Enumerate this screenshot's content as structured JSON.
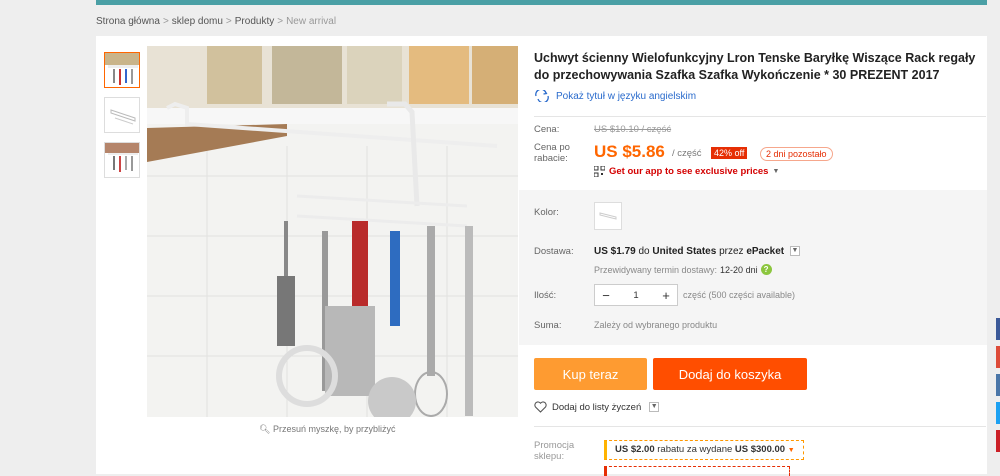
{
  "breadcrumb": {
    "items": [
      "Strona główna",
      "sklep domu",
      "Produkty"
    ],
    "current": "New arrival",
    "separator": ">"
  },
  "gallery": {
    "zoom_hint": "Przesuń myszkę, by przybliżyć"
  },
  "product": {
    "title": "Uchwyt ścienny Wielofunkcyjny Lron Tenske Baryłkę Wiszące Rack regały do przechowywania Szafka Szafka Wykończenie * 30 PREZENT 2017",
    "english_title_link": "Pokaż tytuł w języku angielskim"
  },
  "price": {
    "label": "Cena:",
    "original": "US $10.10 / część",
    "discount_label": "Cena po rabacie:",
    "current": "US $5.86",
    "unit": "/ część",
    "off_badge": "42% off",
    "days_left": "2 dni pozostało",
    "app_promo": "Get our app to see exclusive prices"
  },
  "options": {
    "color_label": "Kolor:",
    "shipping_label": "Dostawa:",
    "shipping_price": "US $1.79",
    "shipping_to_prefix": "do",
    "shipping_country": "United States",
    "shipping_via_prefix": "przez",
    "shipping_method": "ePacket",
    "eta_label": "Przewidywany termin dostawy:",
    "eta_value": "12-20 dni",
    "quantity_label": "Ilość:",
    "quantity_value": "1",
    "availability": "część (500 części available)",
    "total_label": "Suma:",
    "total_value": "Zależy od wybranego produktu"
  },
  "actions": {
    "buy_now": "Kup teraz",
    "add_to_cart": "Dodaj do koszyka",
    "wishlist": "Dodaj do listy życzeń"
  },
  "promotion": {
    "label": "Promocja sklepu:",
    "coupon_value": "US $2.00",
    "coupon_text": "rabatu za wydane",
    "coupon_threshold": "US $300.00"
  },
  "colors": {
    "accent_orange": "#ff4e00",
    "buy_orange": "#fe9b31",
    "price_orange": "#ff6600",
    "badge_red": "#e62e04",
    "top_bar_teal": "#4a9fa5",
    "link_blue": "#2a6bcc"
  }
}
